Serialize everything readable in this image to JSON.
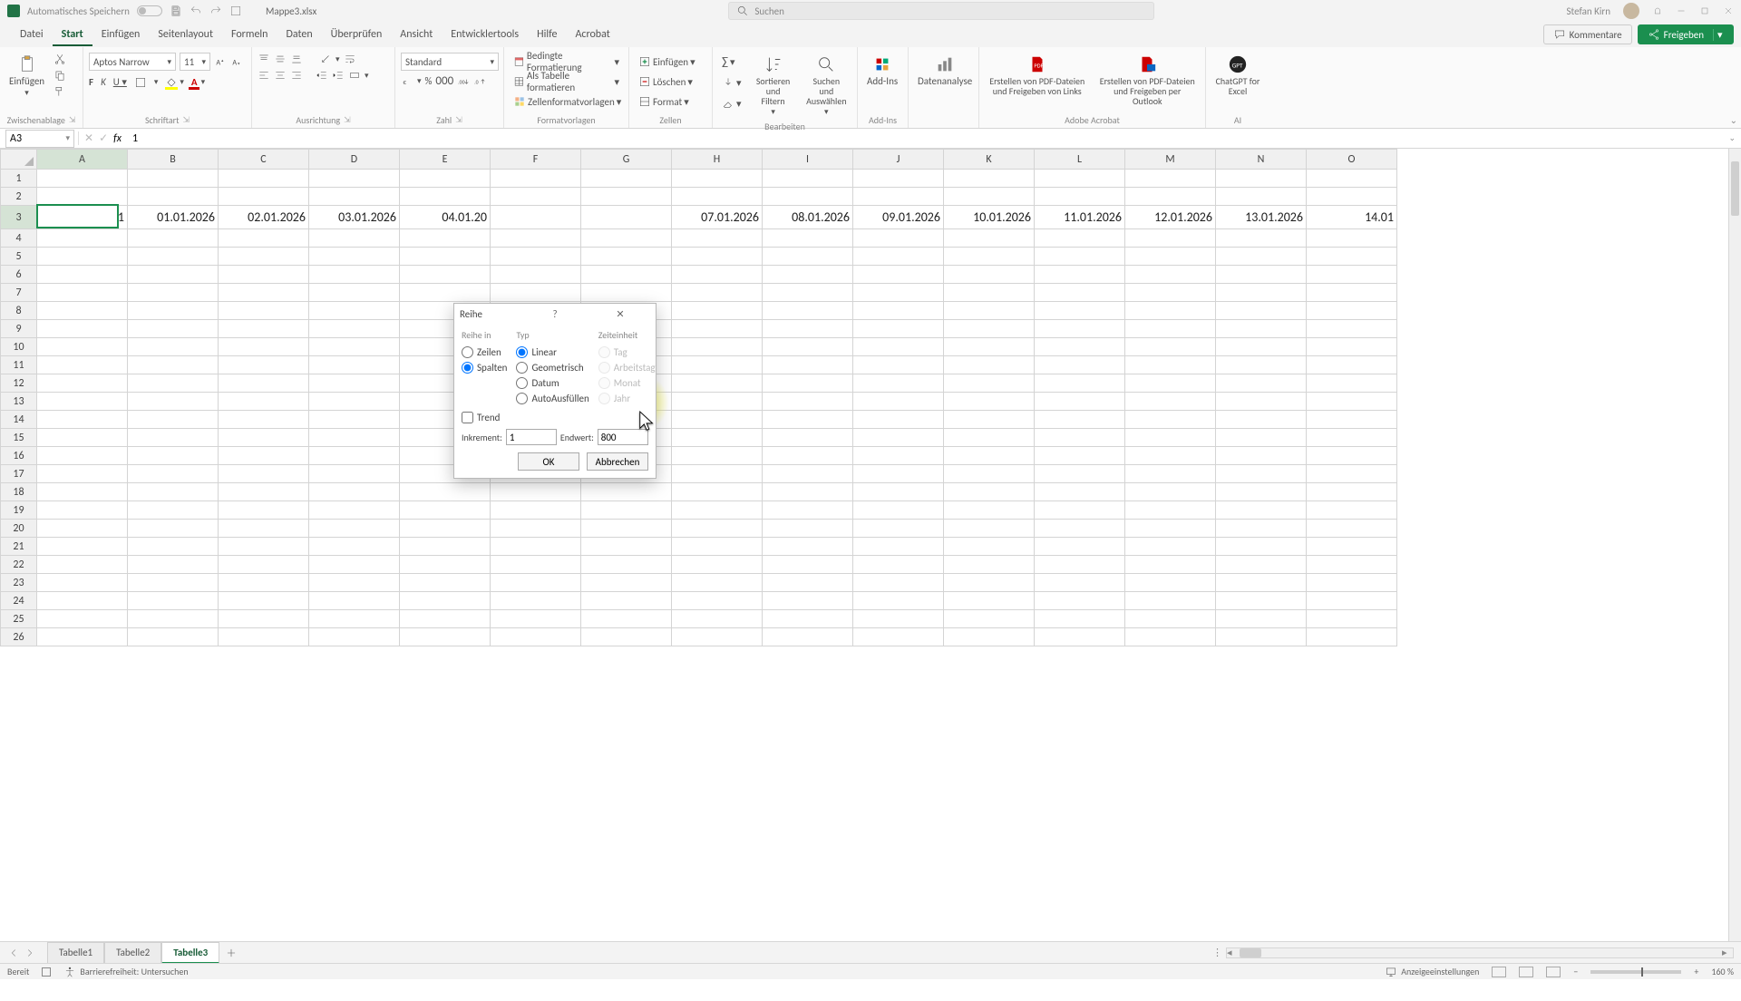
{
  "titlebar": {
    "autosave_label": "Automatisches Speichern",
    "doc_name": "Mappe3.xlsx",
    "search_placeholder": "Suchen",
    "user_name": "Stefan Kirn"
  },
  "tabs": {
    "items": [
      "Datei",
      "Start",
      "Einfügen",
      "Seitenlayout",
      "Formeln",
      "Daten",
      "Überprüfen",
      "Ansicht",
      "Entwicklertools",
      "Hilfe",
      "Acrobat"
    ],
    "active": "Start",
    "kommentare": "Kommentare",
    "freigeben": "Freigeben"
  },
  "ribbon": {
    "clipboard": {
      "paste": "Einfügen",
      "group": "Zwischenablage"
    },
    "font": {
      "family": "Aptos Narrow",
      "size": "11",
      "group": "Schriftart"
    },
    "alignment": {
      "group": "Ausrichtung"
    },
    "number": {
      "format": "Standard",
      "group": "Zahl"
    },
    "styles": {
      "cond": "Bedingte Formatierung",
      "table": "Als Tabelle formatieren",
      "cell": "Zellenformatvorlagen",
      "group": "Formatvorlagen"
    },
    "cells": {
      "insert": "Einfügen",
      "delete": "Löschen",
      "format": "Format",
      "group": "Zellen"
    },
    "editing": {
      "sort": "Sortieren und Filtern",
      "find": "Suchen und Auswählen",
      "group": "Bearbeiten"
    },
    "addins": {
      "addins": "Add-Ins",
      "group": "Add-Ins"
    },
    "data": {
      "analysis": "Datenanalyse"
    },
    "acrobat": {
      "links": "Erstellen von PDF-Dateien und Freigeben von Links",
      "outlook": "Erstellen von PDF-Dateien und Freigeben per Outlook",
      "group": "Adobe Acrobat"
    },
    "ai": {
      "chat": "ChatGPT for Excel",
      "group": "AI"
    }
  },
  "formula": {
    "namebox": "A3",
    "value": "1"
  },
  "columns": [
    "A",
    "B",
    "C",
    "D",
    "E",
    "F",
    "G",
    "H",
    "I",
    "J",
    "K",
    "L",
    "M",
    "N",
    "O"
  ],
  "rowcount": 26,
  "active_cell": {
    "row": 3,
    "col": "A"
  },
  "cells": {
    "r3": {
      "A": "1",
      "B": "01.01.2026",
      "C": "02.01.2026",
      "D": "03.01.2026",
      "E": "04.01.20",
      "H": "07.01.2026",
      "I": "08.01.2026",
      "J": "09.01.2026",
      "K": "10.01.2026",
      "L": "11.01.2026",
      "M": "12.01.2026",
      "N": "13.01.2026",
      "O": "14.01"
    }
  },
  "dialog": {
    "title": "Reihe",
    "groups": {
      "reihe_in": "Reihe in",
      "typ": "Typ",
      "zeit": "Zeiteinheit"
    },
    "reihe_in": {
      "zeilen": "Zeilen",
      "spalten": "Spalten",
      "selected": "spalten"
    },
    "typ": {
      "linear": "Linear",
      "geom": "Geometrisch",
      "datum": "Datum",
      "auto": "AutoAusfüllen",
      "selected": "linear"
    },
    "zeit": {
      "tag": "Tag",
      "arbeit": "Arbeitstag",
      "monat": "Monat",
      "jahr": "Jahr"
    },
    "trend": "Trend",
    "inkrement_label": "Inkrement:",
    "inkrement_value": "1",
    "endwert_label": "Endwert:",
    "endwert_value": "800",
    "ok": "OK",
    "cancel": "Abbrechen",
    "help": "?"
  },
  "sheets": {
    "tabs": [
      "Tabelle1",
      "Tabelle2",
      "Tabelle3"
    ],
    "active": "Tabelle3"
  },
  "status": {
    "ready": "Bereit",
    "access": "Barrierefreiheit: Untersuchen",
    "display": "Anzeigeeinstellungen",
    "zoom": "160 %"
  }
}
